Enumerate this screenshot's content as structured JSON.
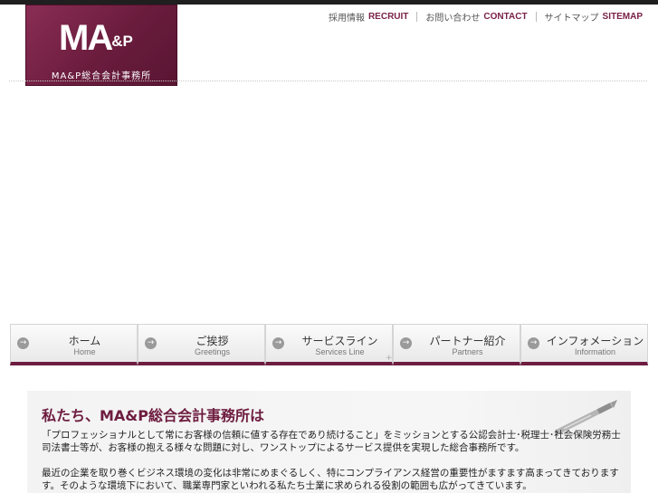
{
  "logo": {
    "mark": "MA",
    "mark_amp": "&P",
    "subtitle": "MA&P総合会計事務所"
  },
  "utility": [
    {
      "ja": "採用情報",
      "en": "RECRUIT"
    },
    {
      "ja": "お問い合わせ",
      "en": "CONTACT"
    },
    {
      "ja": "サイトマップ",
      "en": "SITEMAP"
    }
  ],
  "nav": [
    {
      "ja": "ホーム",
      "en": "Home"
    },
    {
      "ja": "ご挨拶",
      "en": "Greetings"
    },
    {
      "ja": "サービスライン",
      "en": "Services Line"
    },
    {
      "ja": "パートナー紹介",
      "en": "Partners"
    },
    {
      "ja": "インフォメーション",
      "en": "Information"
    }
  ],
  "nav_arrow_glyph": "→",
  "nav_plus": "+",
  "intro": {
    "title": "私たち、MA&P総合会計事務所は",
    "paragraph1_line1": "「プロフェッショナルとして常にお客様の信頼に値する存在であり続けること」をミッションとする公認会計士･税理士･社会保険労務士･",
    "paragraph1_line2": "司法書士等が、お客様の抱える様々な問題に対し、ワンストップによるサービス提供を実現した総合事務所です。",
    "paragraph2_line1": "最近の企業を取り巻くビジネス環境の変化は非常にめまぐるしく、特にコンプライアンス経営の重要性がますます高まってきております",
    "paragraph2_line2": "す。そのような環境下において、職業専門家といわれる私たち士業に求められる役割の範囲も広がってきています。"
  },
  "colors": {
    "brand": "#6e1d40",
    "topbar": "#1f1f1f"
  }
}
